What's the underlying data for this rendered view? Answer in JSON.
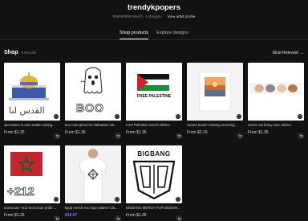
{
  "profile": {
    "username": "trendykpopers",
    "meta_text": "RRRRRRR Merch · 9 designs ·",
    "view_profile": "View artist profile"
  },
  "tabs": [
    {
      "label": "Shop products",
      "active": true
    },
    {
      "label": "Explore designs",
      "active": false
    }
  ],
  "shop": {
    "title": "Shop",
    "results": "9 Results",
    "sort_label": "Most Relevant"
  },
  "products": [
    {
      "title": "Jerusalem is ours arabic writing...",
      "price": "From $1.35",
      "sale": false
    },
    {
      "title": "boo cute ghost for halloween Sti...",
      "price": "From $1.35",
      "sale": false
    },
    {
      "title": "Free Palestine merch Sticker",
      "price": "From $1.35",
      "sale": false
    },
    {
      "title": "sunset beach relaxing Greeting...",
      "price": "From $2.19",
      "sale": false
    },
    {
      "title": "meme cat funny cute Sticker",
      "price": "From $1.35",
      "sale": false
    },
    {
      "title": "moroccan +212 moroccan pride ...",
      "price": "From $1.35",
      "sale": false
    },
    {
      "title": "kpop merch exo logo pattern Cla...",
      "price": "$19.67",
      "sale": true
    },
    {
      "title": "BIGBANG MERCH FOR BIGBANG ...",
      "price": "From $1.35",
      "sale": false
    }
  ],
  "artwork": {
    "arabic": "القدس لنا",
    "boo": "BOO",
    "free_palestine": "FREE PALESTINE",
    "plus212": "+212",
    "bigbang": "BIGBANG"
  },
  "colors": {
    "background": "#121212",
    "sale_price": "#8b6cff"
  }
}
